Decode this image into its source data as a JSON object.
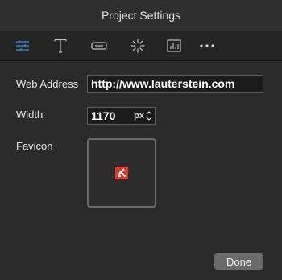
{
  "window": {
    "title": "Project Settings"
  },
  "toolbar": {
    "tabs": [
      {
        "icon": "sliders-icon",
        "active": true
      },
      {
        "icon": "text-icon",
        "active": false
      },
      {
        "icon": "button-icon",
        "active": false
      },
      {
        "icon": "spinner-icon",
        "active": false
      },
      {
        "icon": "chart-icon",
        "active": false
      },
      {
        "icon": "more-icon",
        "active": false
      }
    ],
    "active_color": "#2e95e6"
  },
  "form": {
    "web_address_label": "Web Address",
    "web_address_value": "http://www.lauterstein.com",
    "width_label": "Width",
    "width_value": "1170",
    "width_unit": "px",
    "favicon_label": "Favicon"
  },
  "footer": {
    "done_label": "Done"
  },
  "colors": {
    "background": "#2a2a2a",
    "favicon_red": "#d83b2f"
  }
}
